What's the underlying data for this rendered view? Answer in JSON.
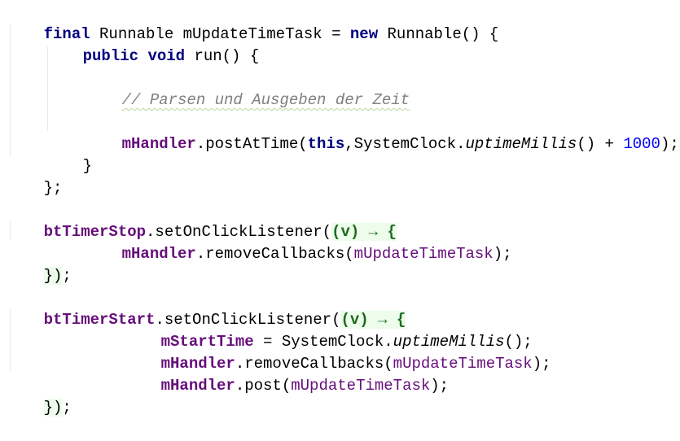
{
  "code": {
    "l1": {
      "kw_final": "final",
      "t1": " Runnable mUpdateTimeTask = ",
      "kw_new": "new",
      "t2": " Runnable() {"
    },
    "l2": {
      "kw_public": "public",
      "sp": " ",
      "kw_void": "void",
      "t1": " run() {"
    },
    "l3": {
      "comment": "// Parsen und Ausgeben der Zeit"
    },
    "l4": {
      "field": "mHandler",
      "t1": ".postAtTime(",
      "kw_this": "this",
      "t2": ",SystemClock.",
      "method": "uptimeMillis",
      "t3": "() + ",
      "num": "1000",
      "t4": ");"
    },
    "l5": {
      "t1": "}"
    },
    "l6": {
      "t1": "};"
    },
    "l7": {
      "field": "btTimerStop",
      "t1": ".setOnClickListener(",
      "lambda": "(v) → {"
    },
    "l8": {
      "field": "mHandler",
      "t1": ".removeCallbacks(",
      "var": "mUpdateTimeTask",
      "t2": ");"
    },
    "l9": {
      "brace": "})",
      "t1": ";"
    },
    "l10": {
      "field": "btTimerStart",
      "t1": ".setOnClickListener(",
      "lambda": "(v) → {"
    },
    "l11": {
      "field": "mStartTime",
      "t1": " = SystemClock.",
      "method": "uptimeMillis",
      "t2": "();"
    },
    "l12": {
      "field": "mHandler",
      "t1": ".removeCallbacks(",
      "var": "mUpdateTimeTask",
      "t2": ");"
    },
    "l13": {
      "field": "mHandler",
      "t1": ".post(",
      "var": "mUpdateTimeTask",
      "t2": ");"
    },
    "l14": {
      "brace": "})",
      "t1": ";"
    }
  },
  "colors": {
    "keyword": "#000080",
    "field": "#660e7a",
    "number": "#0000ff",
    "comment": "#808080",
    "lambda_bg": "#edfceb"
  }
}
